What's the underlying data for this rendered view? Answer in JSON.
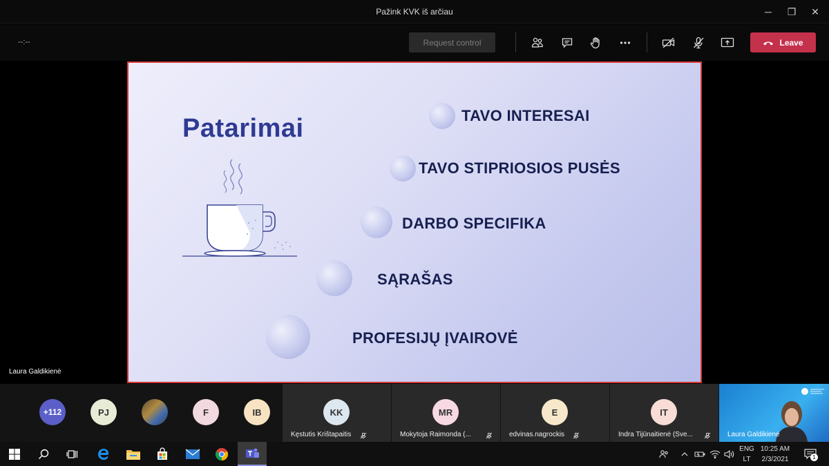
{
  "window": {
    "title": "Pažink KVK iš arčiau",
    "minimize": "─",
    "restore": "❐",
    "close": "✕"
  },
  "toolbar": {
    "timer": "--:--",
    "request_control": "Request control",
    "leave_label": "Leave",
    "leave_color": "#c4314b"
  },
  "slide": {
    "title": "Patarimai",
    "items": [
      "TAVO INTERESAI",
      "TAVO STIPRIOSIOS PUSĖS",
      "DARBO SPECIFIKA",
      "SĄRAŠAS",
      "PROFESIJŲ ĮVAIROVĖ"
    ],
    "title_color": "#2f3a93",
    "item_color": "#161f4f",
    "border_color": "#d63a3a"
  },
  "speaker_name": "Laura Galdikienė",
  "participants_strip": {
    "more_count": "+112",
    "small_avatars": [
      {
        "initials": "PJ",
        "color": "#e8ecd7"
      },
      {
        "initials": "",
        "color": "#777777"
      },
      {
        "initials": "F",
        "color": "#f2d8df"
      },
      {
        "initials": "IB",
        "color": "#f7e3c2"
      }
    ],
    "tiles": [
      {
        "initials": "KK",
        "name": "Kęstutis Krištapaitis",
        "color": "#dde7ef"
      },
      {
        "initials": "MR",
        "name": "Mokytoja Raimonda (...",
        "color": "#f6d9e2"
      },
      {
        "initials": "E",
        "name": "edvinas.nagrockis",
        "color": "#f8e8cb"
      },
      {
        "initials": "IT",
        "name": "Indra Tijūnaitienė (Sve...",
        "color": "#f9dcd6"
      }
    ],
    "self_name": "Laura Galdikienė"
  },
  "taskbar": {
    "lang_top": "ENG",
    "lang_bottom": "LT",
    "time": "10:25 AM",
    "date": "2/3/2021",
    "notification_count": "1"
  }
}
